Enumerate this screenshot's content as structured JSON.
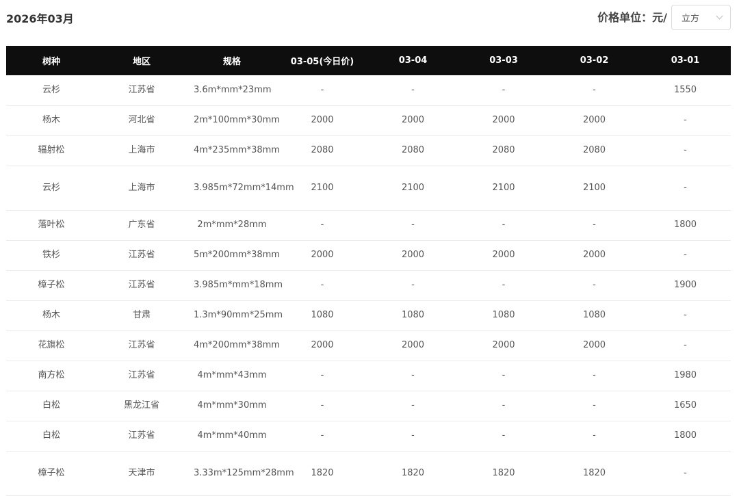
{
  "header": {
    "month": "2026年03月",
    "unit_label": "价格单位：元/",
    "unit_value": "立方"
  },
  "columns": [
    "树种",
    "地区",
    "规格",
    "03-05(今日价)",
    "03-04",
    "03-03",
    "03-02",
    "03-01"
  ],
  "rows": [
    [
      "云杉",
      "江苏省",
      "3.6m*mm*23mm",
      "-",
      "-",
      "-",
      "-",
      "1550"
    ],
    [
      "杨木",
      "河北省",
      "2m*100mm*30mm",
      "2000",
      "2000",
      "2000",
      "2000",
      "-"
    ],
    [
      "辐射松",
      "上海市",
      "4m*235mm*38mm",
      "2080",
      "2080",
      "2080",
      "2080",
      "-"
    ],
    [
      "云杉",
      "上海市",
      "3.985m*72mm*14mm",
      "2100",
      "2100",
      "2100",
      "2100",
      "-"
    ],
    [
      "落叶松",
      "广东省",
      "2m*mm*28mm",
      "-",
      "-",
      "-",
      "-",
      "1800"
    ],
    [
      "铁杉",
      "江苏省",
      "5m*200mm*38mm",
      "2000",
      "2000",
      "2000",
      "2000",
      "-"
    ],
    [
      "樟子松",
      "江苏省",
      "3.985m*mm*18mm",
      "-",
      "-",
      "-",
      "-",
      "1900"
    ],
    [
      "杨木",
      "甘肃",
      "1.3m*90mm*25mm",
      "1080",
      "1080",
      "1080",
      "1080",
      "-"
    ],
    [
      "花旗松",
      "江苏省",
      "4m*200mm*38mm",
      "2000",
      "2000",
      "2000",
      "2000",
      "-"
    ],
    [
      "南方松",
      "江苏省",
      "4m*mm*43mm",
      "-",
      "-",
      "-",
      "-",
      "1980"
    ],
    [
      "白松",
      "黑龙江省",
      "4m*mm*30mm",
      "-",
      "-",
      "-",
      "-",
      "1650"
    ],
    [
      "白松",
      "江苏省",
      "4m*mm*40mm",
      "-",
      "-",
      "-",
      "-",
      "1800"
    ],
    [
      "樟子松",
      "天津市",
      "3.33m*125mm*28mm",
      "1820",
      "1820",
      "1820",
      "1820",
      "-"
    ]
  ]
}
